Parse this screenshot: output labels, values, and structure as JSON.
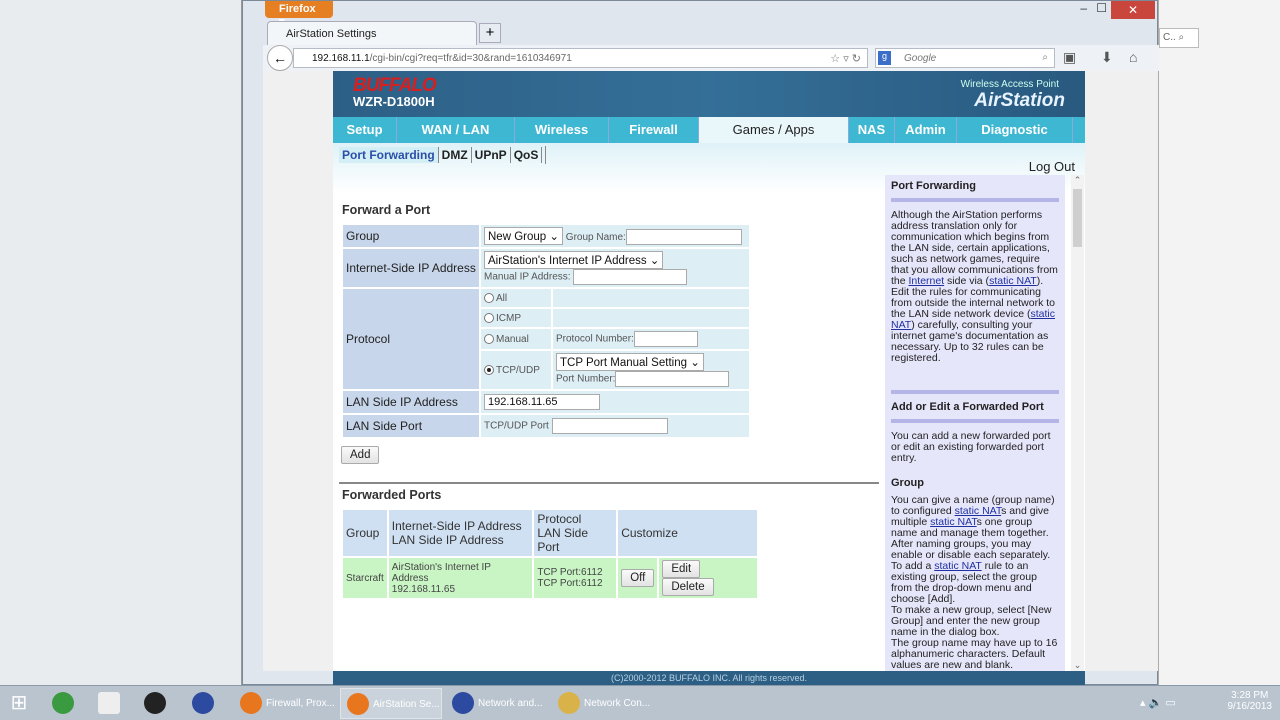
{
  "browser": {
    "menu_label": "Firefox ▾",
    "tab_title": "AirStation Settings",
    "new_tab": "+",
    "url_host": "192.168.11.1",
    "url_path": "/cgi-bin/cgi?req=tfr&id=30&rand=1610346971",
    "search_placeholder": "Google",
    "minimize": "–",
    "maximize": "☐",
    "close": "✕"
  },
  "router": {
    "brand": "BUFFALO",
    "model": "WZR-D1800H",
    "tagline": "Wireless Access Point",
    "product": "AirStation",
    "nav": [
      {
        "label": "Setup"
      },
      {
        "label": "WAN / LAN"
      },
      {
        "label": "Wireless"
      },
      {
        "label": "Firewall"
      },
      {
        "label": "Games / Apps",
        "active": true
      },
      {
        "label": "NAS"
      },
      {
        "label": "Admin"
      },
      {
        "label": "Diagnostic"
      }
    ],
    "subnav": [
      {
        "label": "Port Forwarding",
        "active": true
      },
      {
        "label": "DMZ"
      },
      {
        "label": "UPnP"
      },
      {
        "label": "QoS"
      }
    ],
    "logout": "Log Out",
    "forward": {
      "title": "Forward a Port",
      "group_label": "Group",
      "group_select": "New Group",
      "group_name_label": "Group Name:",
      "group_name_value": "",
      "inet_label": "Internet-Side IP Address",
      "inet_select": "AirStation's Internet IP Address",
      "manual_ip_label": "Manual IP Address:",
      "manual_ip_value": "",
      "protocol_label": "Protocol",
      "proto_all": "All",
      "proto_icmp": "ICMP",
      "proto_manual": "Manual",
      "proto_number_label": "Protocol Number:",
      "proto_tcpudp": "TCP/UDP",
      "proto_selected": "TCP/UDP",
      "tcp_select": "TCP Port Manual Setting",
      "port_number_label": "Port Number:",
      "port_number_value": "",
      "lan_ip_label": "LAN Side IP Address",
      "lan_ip_value": "192.168.11.65",
      "lan_port_label": "LAN Side Port",
      "lan_port_sublabel": "TCP/UDP Port",
      "lan_port_value": "",
      "add_button": "Add"
    },
    "forwarded": {
      "title": "Forwarded Ports",
      "headers": {
        "group": "Group",
        "inet": "Internet-Side IP Address",
        "lan": "LAN Side IP Address",
        "protocol": "Protocol",
        "lanport": "LAN Side Port",
        "customize": "Customize"
      },
      "rows": [
        {
          "group": "Starcraft",
          "inet": "AirStation's Internet IP Address",
          "lan": "192.168.11.65",
          "protocol": "TCP Port:6112",
          "lanport": "TCP Port:6112",
          "off": "Off",
          "edit": "Edit",
          "delete": "Delete"
        }
      ]
    },
    "help": {
      "sections": [
        {
          "title": "Port Forwarding",
          "paras": [
            [
              {
                "t": "Although the AirStation performs address translation only for communication which begins from the LAN side, certain applications, such as network games, require that you allow communications from the "
              },
              {
                "t": "Internet",
                "link": true
              },
              {
                "t": " side via ("
              },
              {
                "t": "static NAT",
                "link": true
              },
              {
                "t": "). Edit the rules for communicating from outside the internal network to the LAN side network device ("
              },
              {
                "t": "static NAT",
                "link": true
              },
              {
                "t": ") carefully, consulting your internet game's documentation as necessary. Up to 32 rules can be registered."
              }
            ]
          ]
        },
        {
          "title": "Add or Edit a Forwarded Port",
          "paras": [
            [
              {
                "t": "You can add a new forwarded port or edit an existing forwarded port entry."
              }
            ]
          ]
        },
        {
          "title": "Group",
          "nobar": true,
          "paras": [
            [
              {
                "t": "You can give a name (group name) to configured "
              },
              {
                "t": "static NAT",
                "link": true
              },
              {
                "t": "s and give multiple "
              },
              {
                "t": "static NAT",
                "link": true
              },
              {
                "t": "s one group name and manage them together. After naming groups, you may enable or disable each separately. To add a "
              },
              {
                "t": "static NAT",
                "link": true
              },
              {
                "t": " rule to an existing group, select the group from the drop-down menu and choose [Add]."
              }
            ],
            [
              {
                "t": "To make a new group, select [New Group] and enter the new group name in the dialog box."
              }
            ],
            [
              {
                "t": "The group name may have up to 16 alphanumeric characters. Default values are new and blank."
              }
            ]
          ]
        }
      ]
    },
    "footer": "(C)2000-2012 BUFFALO INC. All rights reserved."
  },
  "taskbar": {
    "items": [
      {
        "label": "Firewall, Prox...",
        "color": "#e8761f"
      },
      {
        "label": "AirStation Se...",
        "color": "#e8761f"
      },
      {
        "label": "Network and...",
        "color": "#2c4aa0"
      },
      {
        "label": "Network Con...",
        "color": "#d9b24a"
      }
    ],
    "time": "3:28 PM",
    "date": "9/16/2013"
  },
  "colors": {
    "header": "#2d5f86",
    "nav": "#3eb7d3",
    "help_bg": "#e6e6fb",
    "row_bg": "#c9f5c5",
    "label_bg": "#c7d6ea"
  }
}
